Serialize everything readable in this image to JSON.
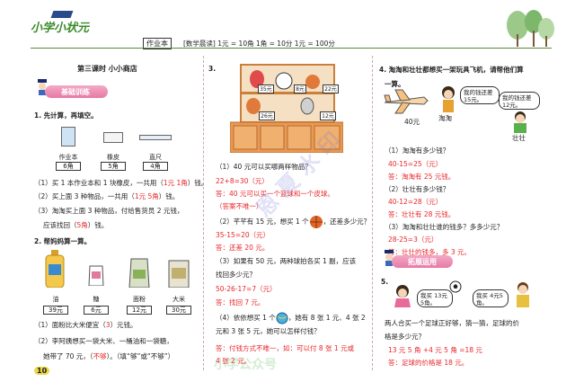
{
  "header": {
    "logo_text": "小学小状元",
    "workbook": "作业本",
    "morning_read": "[数学晨读] 1元 = 10角   1角 = 10分   1元 = 100分"
  },
  "col1": {
    "lesson": "第三课时  小小商店",
    "section1": "基础训练",
    "q1": "1. 先计算，再填空。",
    "items": [
      {
        "label": "作业本",
        "price": "6角"
      },
      {
        "label": "橡皮",
        "price": "5角"
      },
      {
        "label": "直尺",
        "price": "4角"
      }
    ],
    "q1_1a": "（1）买 1 本作业本和 1 块橡皮，一共用（",
    "q1_1ans": "1元 1角",
    "q1_1b": "）钱。",
    "q1_2a": "（2）买上面 3 种物品，一共用（",
    "q1_2ans": "1元 5角",
    "q1_2b": "）钱。",
    "q1_3a": "（3）淘淘买上面 3 种物品，付给售货员 2 元钱，",
    "q1_3b": "应该找回（",
    "q1_3ans": "5角",
    "q1_3c": "）钱。",
    "q2": "2. 帮妈妈算一算。",
    "goods": [
      {
        "label": "油",
        "price": "39元"
      },
      {
        "label": "糖",
        "price": "6元"
      },
      {
        "label": "面粉",
        "price": "12元"
      },
      {
        "label": "大米",
        "price": "30元"
      }
    ],
    "q2_1a": "（1）面粉比大米便宜（",
    "q2_1ans": "3",
    "q2_1b": "）元钱。",
    "q2_2a": "（2）李阿姨想买一袋大米、一桶油和一袋糖，",
    "q2_2b": "她带了 70 元，（",
    "q2_2ans": "不够",
    "q2_2c": "）。（填“够”或“不够”）",
    "page_number": "10"
  },
  "col2": {
    "q3": "3.",
    "shelf_prices": [
      "35元",
      "8元",
      "22元",
      "26元",
      "12元"
    ],
    "a1": "（1）40 元可以买哪两样物品？",
    "a1_ans1": "22+8=30（元）",
    "a1_ans2": "答：40 元可以买一个篮球和一个皮球。",
    "a1_ans3": "（答案不唯一）",
    "a2a": "（2）芊芊有 15 元，想买 1 个",
    "a2b": "，还差多少元？",
    "a2_ans1": "35-15=20（元）",
    "a2_ans2": "答：还差 20 元。",
    "a3a": "（3）如果有 50 元，两种球拍各买 1 副，应该",
    "a3b": "找回多少元？",
    "a3_ans1": "50-26-17=7（元）",
    "a3_ans2": "答：找回 7 元。",
    "a4a": "（4）依依想买 1 个",
    "a4b": "，她有 8 张 1 元、4 张 2",
    "a4c": "元和 3 张 5 元，她可以怎样付钱？",
    "a4_ans1": "答：付钱方式不唯一，如：可以付 8 张 1 元或",
    "a4_ans2": "4 张 2 元。"
  },
  "col3": {
    "q4": "4. 淘淘和壮壮都想买一架玩具飞机，请帮他们算",
    "q4b": "一算。",
    "plane_price": "40元",
    "bubble1": "我的钱还差 15元。",
    "bubble2": "我的钱还差 12元。",
    "name1": "淘淘",
    "name2": "壮壮",
    "b1": "（1）淘淘有多少钱？",
    "b1_ans1": "40-15=25（元）",
    "b1_ans2": "答：淘淘有 25 元钱。",
    "b2": "（2）壮壮有多少钱？",
    "b2_ans1": "40-12=28（元）",
    "b2_ans2": "答：壮壮有 28 元钱。",
    "b3": "（3）淘淘和壮壮谁的钱多？多多少元？",
    "b3_ans1": "28-25=3（元）",
    "b3_ans2": "答：壮壮的钱多，多 3 元。",
    "section2": "拓展运用",
    "q5": "5.",
    "bubble3": "我买 13元5角。",
    "bubble4": "我买 4元5角。",
    "q5_text1": "两人合买一个足球正好够，猜一猜，足球的价",
    "q5_text2": "格是多少元？",
    "q5_ans1": "13 元 5 角 +4 元 5 角 =18 元",
    "q5_ans2": "答：足球的价格是 18 元。"
  },
  "watermark": "恩 夏 水 印",
  "watermark2": "小学公众号"
}
